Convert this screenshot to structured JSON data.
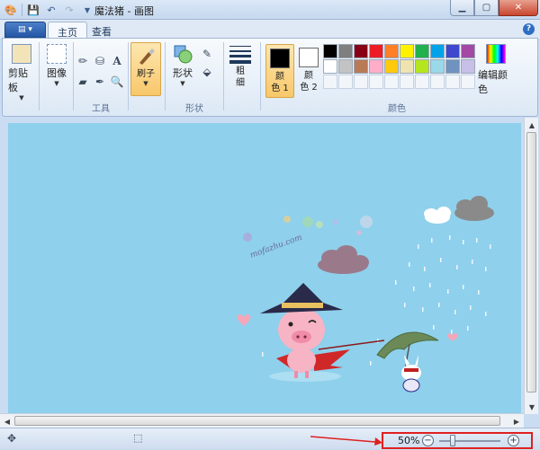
{
  "window": {
    "title": "魔法猪 - 画图"
  },
  "tabs": [
    {
      "label": "主页"
    },
    {
      "label": "查看"
    }
  ],
  "ribbon": {
    "clipboard": {
      "label": "剪贴板"
    },
    "image": {
      "label": "图像"
    },
    "tools": {
      "group_label": "工具"
    },
    "brushes": {
      "label": "刷子"
    },
    "shapes": {
      "button_label": "形状",
      "group_label": "形状"
    },
    "size": {
      "label_line1": "粗",
      "label_line2": "细"
    },
    "colors": {
      "color1_line1": "颜",
      "color1_line2": "色 1",
      "color2_line1": "颜",
      "color2_line2": "色 2",
      "edit_label": "编辑颜色",
      "group_label": "颜色",
      "color1_value": "#000000",
      "color2_value": "#ffffff",
      "palette": [
        "#000000",
        "#7f7f7f",
        "#880015",
        "#ed1c24",
        "#ff7f27",
        "#fff200",
        "#22b14c",
        "#00a2e8",
        "#3f48cc",
        "#a349a4",
        "#ffffff",
        "#c3c3c3",
        "#b97a57",
        "#ffaec9",
        "#ffc90e",
        "#efe4b0",
        "#b5e61d",
        "#99d9ea",
        "#7092be",
        "#c8bfe7"
      ]
    }
  },
  "canvas": {
    "background": "#8fd0ec",
    "watermark": "mofazhu.com"
  },
  "statusbar": {
    "zoom_text": "50%",
    "zoom_level": 0.5
  }
}
